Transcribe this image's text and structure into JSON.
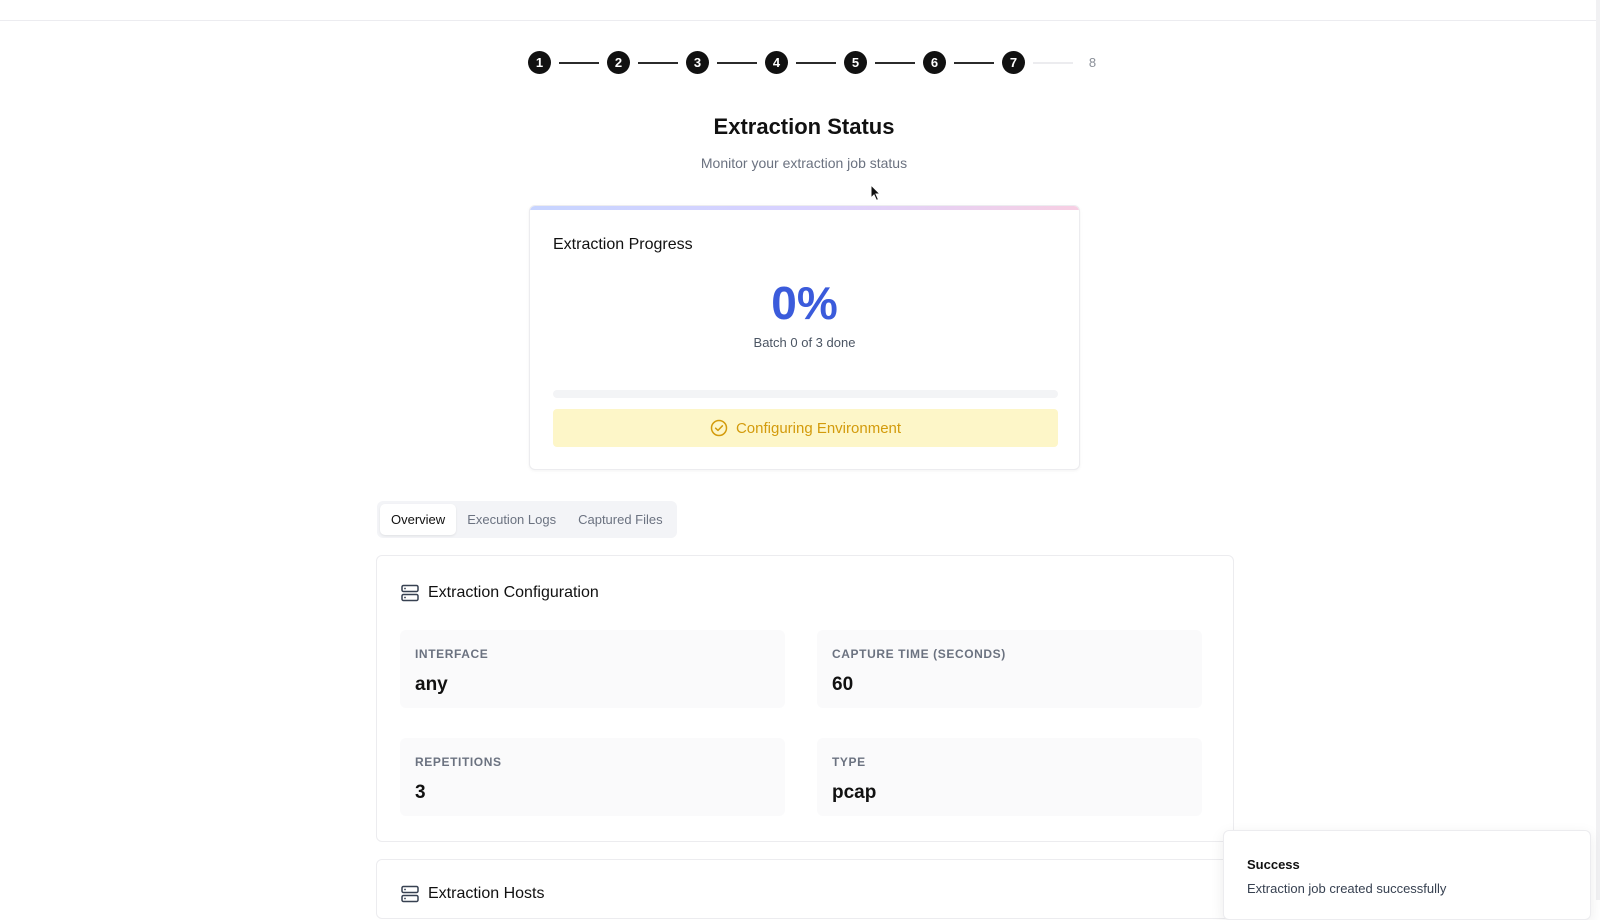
{
  "stepper": {
    "steps": [
      "1",
      "2",
      "3",
      "4",
      "5",
      "6",
      "7",
      "8"
    ],
    "current_step": 8
  },
  "header": {
    "title": "Extraction Status",
    "subtitle": "Monitor your extraction job status"
  },
  "progress_card": {
    "title": "Extraction Progress",
    "percent_label": "0%",
    "progress_fraction": 0,
    "batch_text": "Batch 0 of 3 done",
    "status_text": "Configuring Environment",
    "status_color": "#d39b0c",
    "percent_color": "#3b5bdb"
  },
  "tabs": [
    {
      "label": "Overview",
      "active": true
    },
    {
      "label": "Execution Logs",
      "active": false
    },
    {
      "label": "Captured Files",
      "active": false
    }
  ],
  "config": {
    "title": "Extraction Configuration",
    "fields": [
      {
        "key": "INTERFACE",
        "value": "any"
      },
      {
        "key": "CAPTURE TIME (SECONDS)",
        "value": "60"
      },
      {
        "key": "REPETITIONS",
        "value": "3"
      },
      {
        "key": "TYPE",
        "value": "pcap"
      }
    ]
  },
  "hosts": {
    "title": "Extraction Hosts"
  },
  "toast": {
    "title": "Success",
    "message": "Extraction job created successfully"
  },
  "icons": {
    "section_icon": "server-icon",
    "status_icon": "check-circle-icon"
  }
}
